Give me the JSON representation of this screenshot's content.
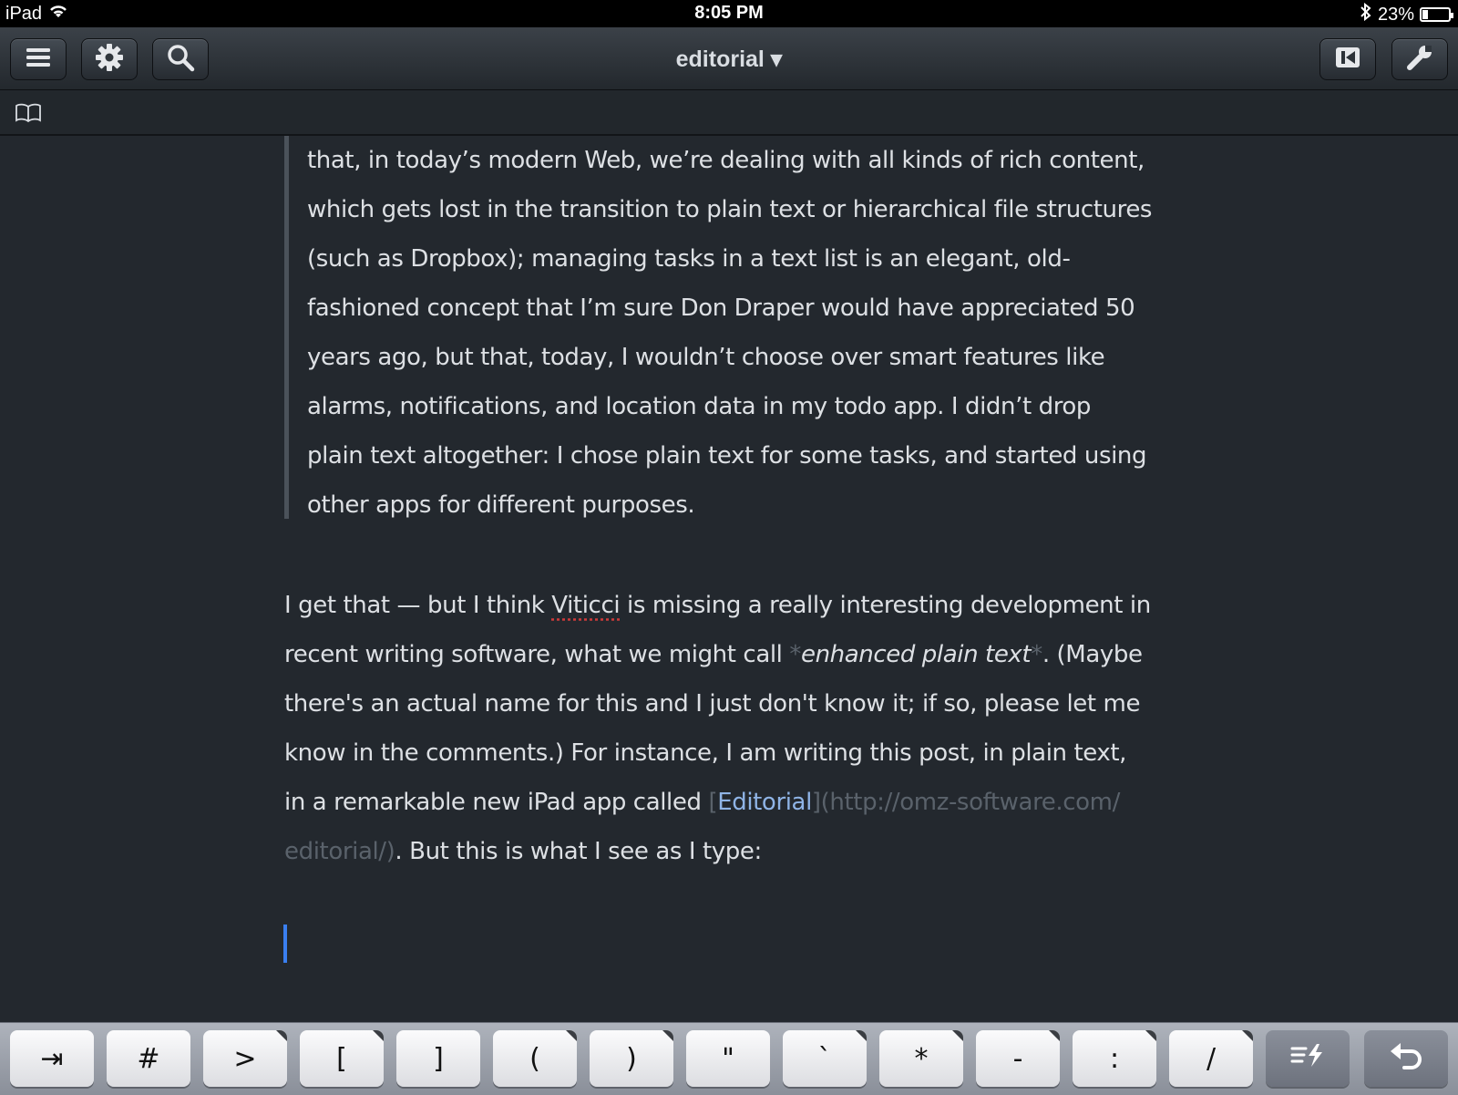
{
  "status_bar": {
    "device": "iPad",
    "time": "8:05 PM",
    "battery": "23%",
    "battery_level": 0.23,
    "icons": [
      "wifi-icon",
      "bluetooth-icon",
      "battery-icon"
    ]
  },
  "navbar": {
    "title": "editorial ▾",
    "left_buttons": [
      "menu-icon",
      "gear-icon",
      "search-icon"
    ],
    "right_buttons": [
      "skip-back-icon",
      "wrench-icon"
    ]
  },
  "subbar": {
    "icon": "book-icon"
  },
  "document": {
    "quote_lines": [
      "that, in today’s modern Web, we’re dealing with all kinds of rich content,",
      "which gets lost in the transition to plain text or hierarchical file structures",
      "(such as Dropbox); managing tasks in a text list is an elegant, old-",
      "fashioned concept that I’m sure Don Draper would have appreciated 50",
      "years ago, but that, today, I wouldn’t choose over smart features like",
      "alarms, notifications, and location data in my todo app. I didn’t drop",
      "plain text altogether: I chose plain text for some tasks, and started using",
      "other apps for different purposes."
    ],
    "para": {
      "l1_a": "I get that — but I think ",
      "l1_spell": "Viticci",
      "l1_b": " is missing a really interesting development in",
      "l2_a": "recent writing software, what we might call ",
      "l2_star1": "*",
      "l2_em": "enhanced plain text",
      "l2_star2": "*",
      "l2_b": ". (Maybe",
      "l3": "there's an actual name for this and I just don't know it; if so, please let me",
      "l4": "know in the comments.) For instance, I am writing this post, in plain text,",
      "l5_a": "in a remarkable new iPad app called ",
      "l5_br1": "[",
      "l5_link": "Editorial",
      "l5_br2": "]",
      "l5_url": "(http://omz-software.com/",
      "l6_url": "editorial/)",
      "l6_b": ".  But this is what I see as I type:"
    }
  },
  "keyboard_row": {
    "keys": [
      "⇥",
      "#",
      ">",
      "[",
      "]",
      "(",
      ")",
      "\"",
      "`",
      "*",
      "-",
      ":",
      "/",
      "≡⚡",
      "↶"
    ]
  },
  "colors": {
    "background": "#23282e",
    "link": "#8fb4e6",
    "cursor": "#3a7ff0",
    "markup_dim": "#5a626b"
  }
}
